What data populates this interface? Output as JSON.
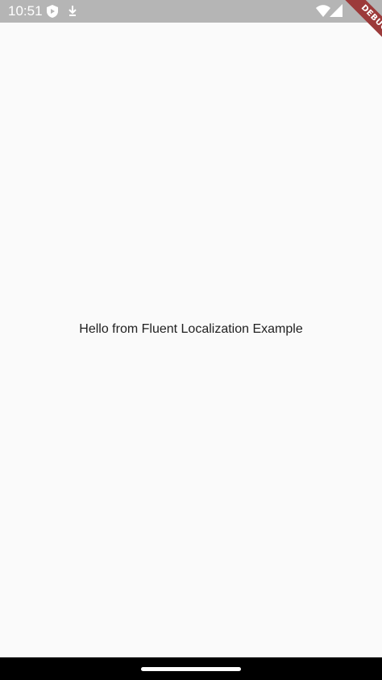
{
  "status_bar": {
    "time": "10:51",
    "icons": [
      "play-protect-icon",
      "download-icon",
      "wifi-icon",
      "cell-signal-icon"
    ]
  },
  "debug_banner": {
    "label": "DEBUG",
    "color": "#9c3a3a"
  },
  "main": {
    "message": "Hello from Fluent Localization Example"
  },
  "nav_bar": {
    "handle": "home-gesture-handle"
  },
  "colors": {
    "status_bar_bg": "#b5b5b5",
    "page_bg": "#fafafa",
    "text": "#212121",
    "nav_bg": "#000000"
  }
}
